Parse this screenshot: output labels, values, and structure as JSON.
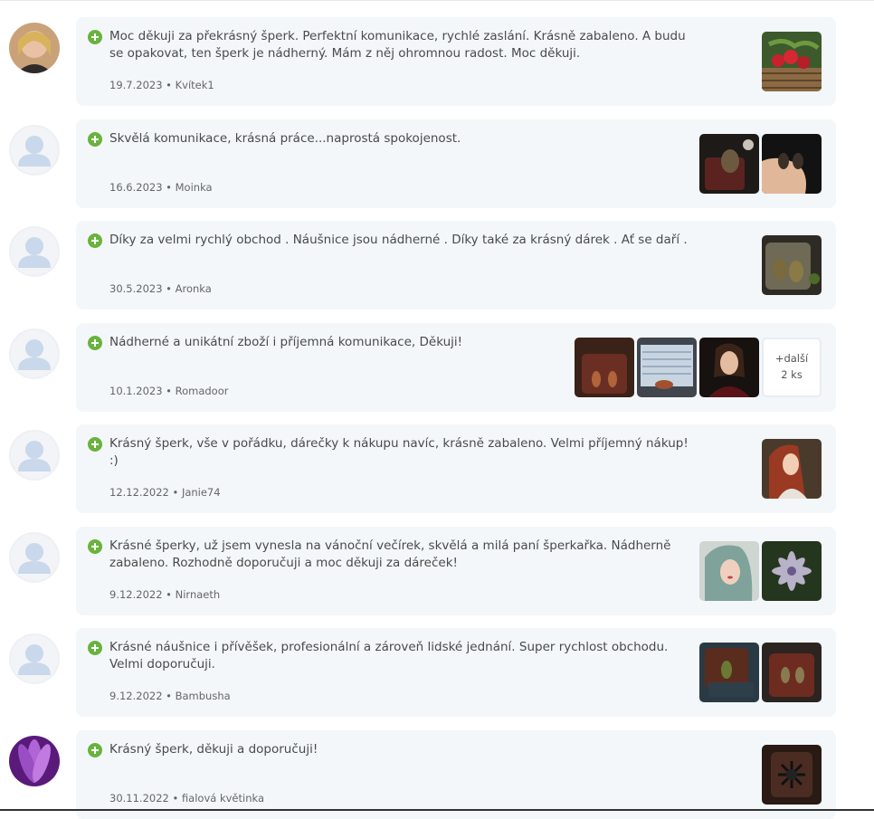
{
  "reviews": [
    {
      "text": "Moc děkuji za překrásný šperk. Perfektní komunikace, rychlé zaslání. Krásně zabaleno. A budu se opakovat, ten šperk je nádherný. Mám z něj ohromnou radost. Moc děkuji.",
      "date": "19.7.2023",
      "author": "Kvítek1",
      "meta": "19.7.2023 • Kvítek1"
    },
    {
      "text": "Skvělá komunikace, krásná práce...naprostá spokojenost.",
      "date": "16.6.2023",
      "author": "Moinka",
      "meta": "16.6.2023 • Moinka"
    },
    {
      "text": "Díky za velmi rychlý obchod . Náušnice jsou nádherné . Díky také za krásný dárek . Ať se daří .",
      "date": "30.5.2023",
      "author": "Aronka",
      "meta": "30.5.2023 • Aronka"
    },
    {
      "text": "Nádherné a unikátní zboží i příjemná komunikace, Děkuji!",
      "date": "10.1.2023",
      "author": "Romadoor",
      "meta": "10.1.2023 • Romadoor",
      "more_line1": "+další",
      "more_line2": "2 ks"
    },
    {
      "text": "Krásný šperk, vše v pořádku, dárečky k nákupu navíc, krásně zabaleno. Velmi příjemný nákup! :)",
      "date": "12.12.2022",
      "author": "Janie74",
      "meta": "12.12.2022 • Janie74"
    },
    {
      "text": "Krásné šperky, už jsem vynesla na vánoční večírek, skvělá a milá paní šperkařka. Nádherně zabaleno. Rozhodně doporučuji a moc děkuji za dáreček!",
      "date": "9.12.2022",
      "author": "Nirnaeth",
      "meta": "9.12.2022 • Nirnaeth"
    },
    {
      "text": "Krásné náušnice i přívěšek, profesionální a zároveň lidské jednání. Super rychlost obchodu. Velmi doporučuji.",
      "date": "9.12.2022",
      "author": "Bambusha",
      "meta": "9.12.2022 • Bambusha"
    },
    {
      "text": "Krásný šperk, děkuji a doporučuji!",
      "date": "30.11.2022",
      "author": "fialová květinka",
      "meta": "30.11.2022 • fialová květinka"
    }
  ],
  "colors": {
    "card_background": "#f3f7fa",
    "positive_icon": "#69b33d",
    "default_avatar": "#c9d8ea"
  },
  "icons": {
    "positive": "plus-circle-icon",
    "default_avatar": "user-silhouette-icon"
  }
}
